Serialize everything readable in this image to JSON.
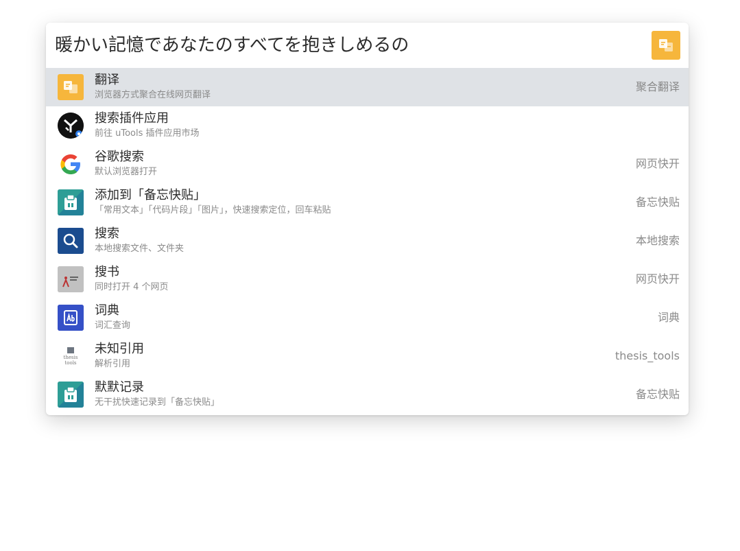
{
  "search": {
    "value": "暖かい記憶であなたのすべてを抱きしめるの",
    "plugin_icon": "translate-icon",
    "accent": "#f6b63c"
  },
  "results": [
    {
      "title": "翻译",
      "desc": "浏览器方式聚合在线网页翻译",
      "tag": "聚合翻译",
      "icon": "translate-icon",
      "selected": true
    },
    {
      "title": "搜索插件应用",
      "desc": "前往 uTools 插件应用市场",
      "tag": "",
      "icon": "utools-icon"
    },
    {
      "title": "谷歌搜索",
      "desc": "默认浏览器打开",
      "tag": "网页快开",
      "icon": "google-icon"
    },
    {
      "title": "添加到「备忘快贴」",
      "desc": "「常用文本」「代码片段」「图片」，快速搜索定位，回车粘贴",
      "tag": "备忘快贴",
      "icon": "clipboard-icon"
    },
    {
      "title": "搜索",
      "desc": "本地搜索文件、文件夹",
      "tag": "本地搜索",
      "icon": "magnifier-icon"
    },
    {
      "title": "搜书",
      "desc": "同时打开 4 个网页",
      "tag": "网页快开",
      "icon": "book-search-icon"
    },
    {
      "title": "词典",
      "desc": "词汇查询",
      "tag": "词典",
      "icon": "dictionary-icon"
    },
    {
      "title": "未知引用",
      "desc": "解析引用",
      "tag": "thesis_tools",
      "icon": "thesis-tools-icon",
      "icon_text": [
        "thesis",
        "tools"
      ]
    },
    {
      "title": "默默记录",
      "desc": "无干扰快速记录到「备忘快贴」",
      "tag": "备忘快贴",
      "icon": "clipboard-icon"
    }
  ]
}
